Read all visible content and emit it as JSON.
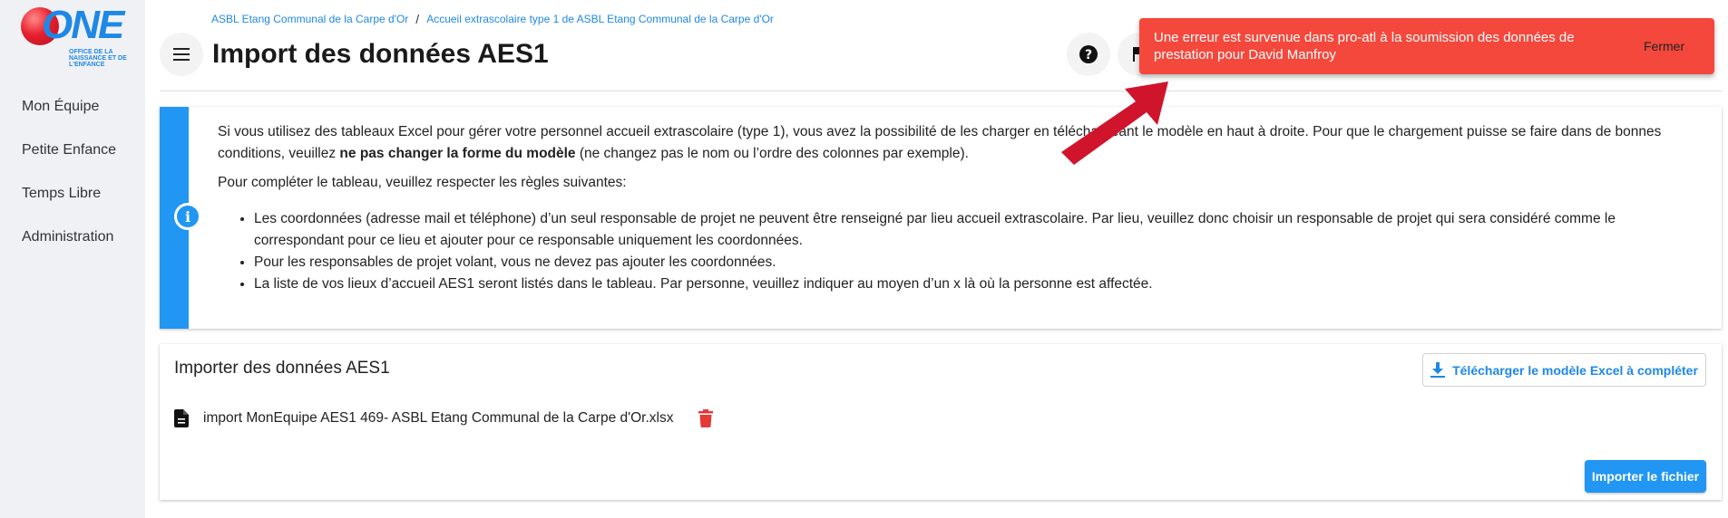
{
  "logo": {
    "text": "ONE",
    "subtitle": "OFFICE DE LA NAISSANCE ET DE L'ENFANCE"
  },
  "sidebar": {
    "items": [
      {
        "label": "Mon Équipe"
      },
      {
        "label": "Petite Enfance"
      },
      {
        "label": "Temps Libre"
      },
      {
        "label": "Administration"
      }
    ]
  },
  "breadcrumb": {
    "items": [
      "ASBL Etang Communal de la Carpe d'Or",
      "Accueil extrascolaire type 1 de ASBL Etang Communal de la Carpe d'Or"
    ],
    "separator": "/"
  },
  "header": {
    "title": "Import des données AES1"
  },
  "info": {
    "p1_start": "Si vous utilisez des tableaux Excel pour gérer votre personnel accueil extrascolaire (type 1), vous avez la possibilité de les charger ",
    "p1_hidden": "en téléchargeant le mo",
    "p1_end": "dèle en haut à droite. Pour que le chargement puisse se faire dans de bonnes conditions, veuillez ",
    "p1_bold": "ne pas changer la forme du modèle",
    "p1_tail": " (ne changez pas le nom ou l’ordre des colonnes par exemple).",
    "p2": "Pour compléter le tableau, veuillez respecter les règles suivantes:",
    "rules": [
      "Les coordonnées (adresse mail et téléphone) d’un seul responsable de projet ne peuvent être renseigné par lieu accueil extrascolaire. Par lieu, veuillez donc choisir un responsable de projet qui sera considéré comme le correspondant pour ce lieu et ajouter pour ce responsable uniquement les coordonnées.",
      "Pour les responsables de projet volant, vous ne devez pas ajouter les coordonnées.",
      "La liste de vos lieux d’accueil AES1 seront listés dans le tableau. Par personne, veuillez indiquer au moyen d’un x là où la personne est affectée."
    ]
  },
  "import": {
    "title": "Importer des données AES1",
    "download_label": "Télécharger le modèle Excel à compléter",
    "file_name": "import MonEquipe AES1 469- ASBL Etang Communal de la Carpe d'Or.xlsx",
    "submit_label": "Importer le fichier"
  },
  "toast": {
    "message": "Une erreur est survenue dans pro-atl à la soumission des données de prestation pour David Manfroy",
    "close_label": "Fermer"
  },
  "colors": {
    "accent": "#2196f3",
    "toast": "#f4483c",
    "arrow": "#d0142c",
    "delete": "#e53935"
  },
  "icons": [
    "menu-icon",
    "help-icon",
    "flag-icon",
    "info-icon",
    "download-icon",
    "file-icon",
    "trash-icon"
  ]
}
